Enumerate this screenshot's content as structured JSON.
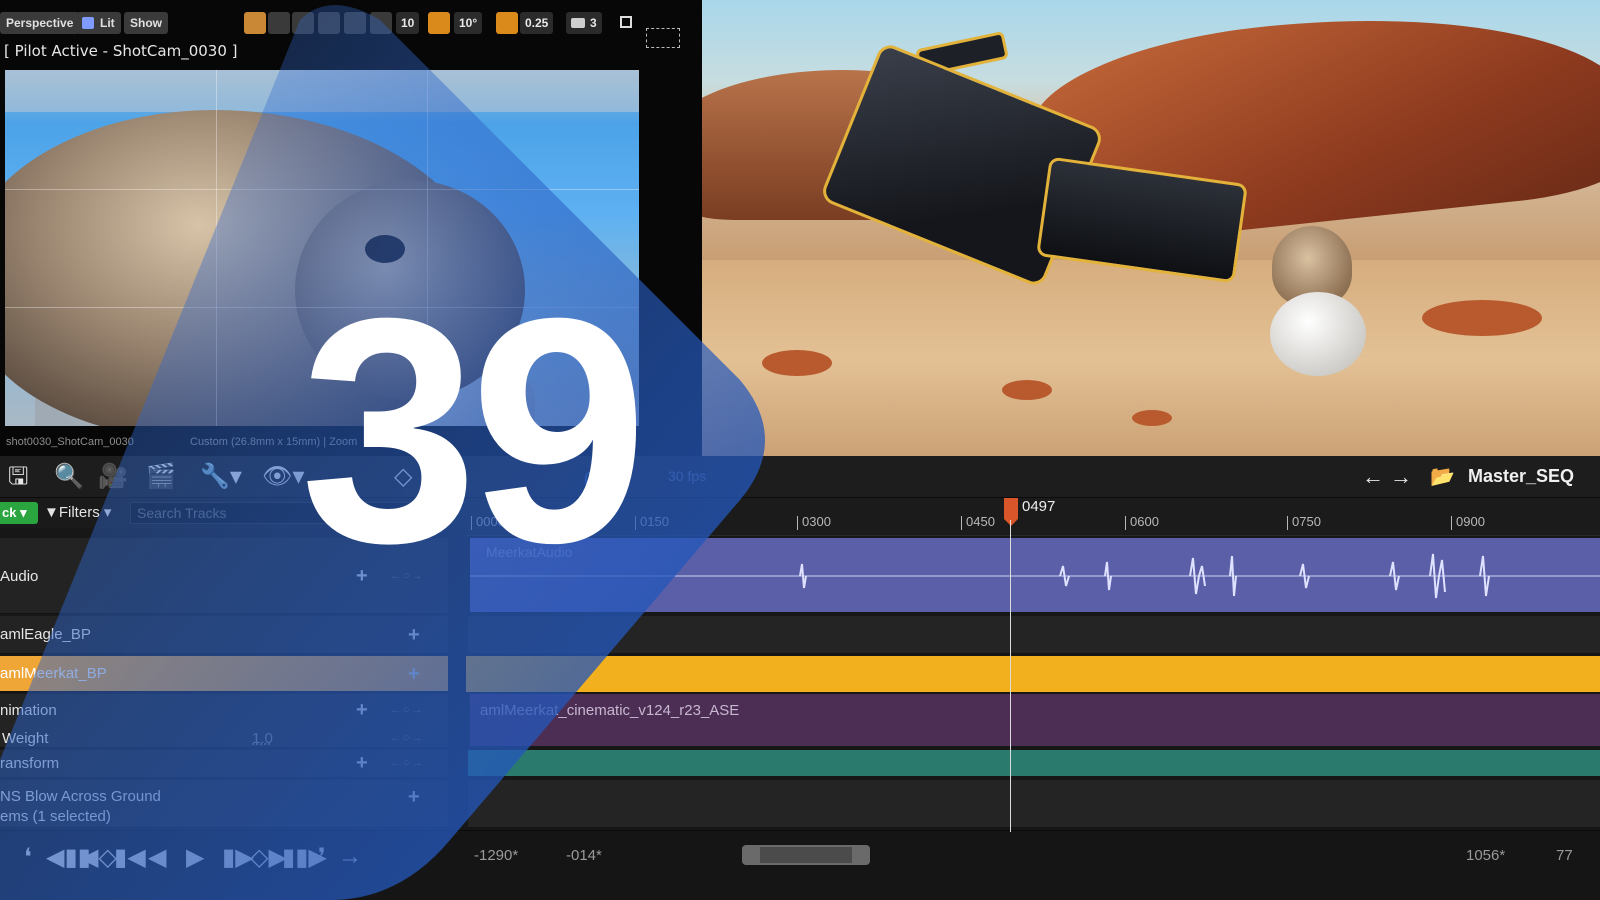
{
  "viewport_left": {
    "toolbar": {
      "perspective_label": "Perspective",
      "lit_label": "Lit",
      "show_label": "Show",
      "grid_snap_value": "10",
      "rotation_snap_value": "10°",
      "scale_snap_value": "0.25",
      "camera_speed_value": "3"
    },
    "pilot_label": "[ Pilot Active - ShotCam_0030 ]",
    "shot_label": "shot0030_ShotCam_0030",
    "lens_label": "Custom (26.8mm x 15mm) | Zoom"
  },
  "sequencer": {
    "fps_label": "30 fps",
    "sequence_title": "Master_SEQ",
    "track_button_label": "ck",
    "filters_label": "Filters",
    "search_placeholder": "Search Tracks",
    "playhead_frame": "0497",
    "ruler_ticks": [
      "0000",
      "0150",
      "0300",
      "0450",
      "0600",
      "0750",
      "0900"
    ],
    "tracks": [
      {
        "name": "Audio",
        "clip": "MeerkatAudio"
      },
      {
        "name": "amlEagle_BP"
      },
      {
        "name": "amlMeerkat_BP"
      },
      {
        "name": "nimation",
        "clip": "amlMeerkat_cinematic_v124_r23_ASE"
      },
      {
        "name": "Weight",
        "value": "1.0"
      },
      {
        "name": "ransform"
      },
      {
        "name": "NS Blow Across Ground"
      }
    ],
    "items_status": "ems (1 selected)",
    "transport": {
      "in_value": "-1290*",
      "start_value": "-014*",
      "end_value": "1056*",
      "out_value": "77"
    }
  },
  "badge": {
    "number": "39",
    "color_dark": "#1f4fb0",
    "color_light": "#3a73d8"
  },
  "colors": {
    "selection_orange": "#f2b01e",
    "audio_clip": "#5a5fa8",
    "animation_clip": "#4c2e55",
    "transform_bar": "#2a7b6d",
    "add_track_green": "#2ba540"
  }
}
